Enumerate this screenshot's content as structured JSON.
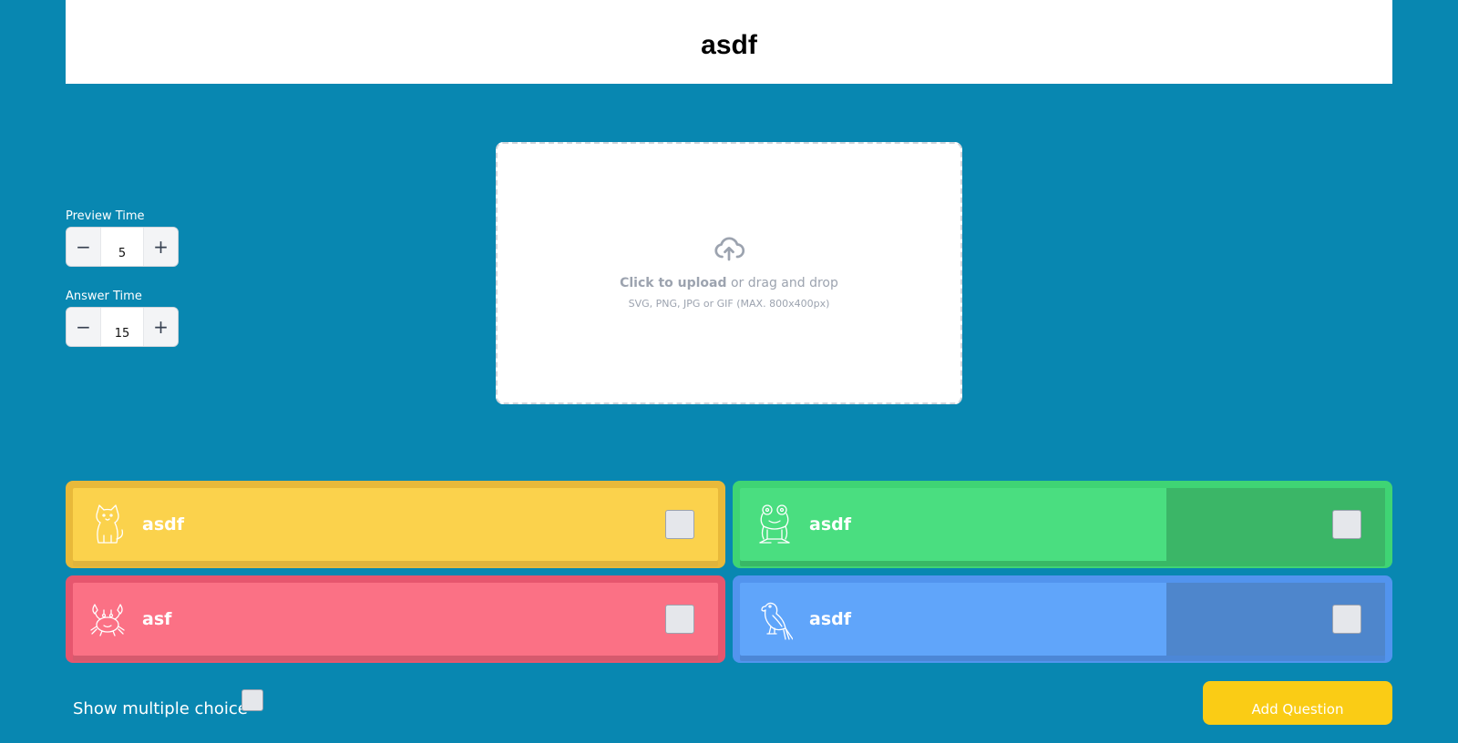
{
  "title": "asdf",
  "preview_time": {
    "label": "Preview Time",
    "value": "5",
    "minus": "−",
    "plus": "+"
  },
  "answer_time": {
    "label": "Answer Time",
    "value": "15",
    "minus": "−",
    "plus": "+"
  },
  "upload": {
    "click_text": "Click to upload",
    "drag_text": " or drag and drop",
    "formats": "SVG, PNG, JPG or GIF (MAX. 800x400px)",
    "icon": "cloud-upload-icon"
  },
  "answers": [
    {
      "text": "asdf",
      "icon": "cat-icon",
      "color": "#fbd24c"
    },
    {
      "text": "asdf",
      "icon": "frog-icon",
      "color": "#4ade80"
    },
    {
      "text": "asf",
      "icon": "crab-icon",
      "color": "#fb7185"
    },
    {
      "text": "asdf",
      "icon": "parrot-icon",
      "color": "#60a5fa"
    }
  ],
  "show_multiple_choice": {
    "label": "Show multiple choice"
  },
  "add_question": {
    "label": "Add Question",
    "color": "#facc15"
  },
  "colors": {
    "background": "#0887b1"
  }
}
